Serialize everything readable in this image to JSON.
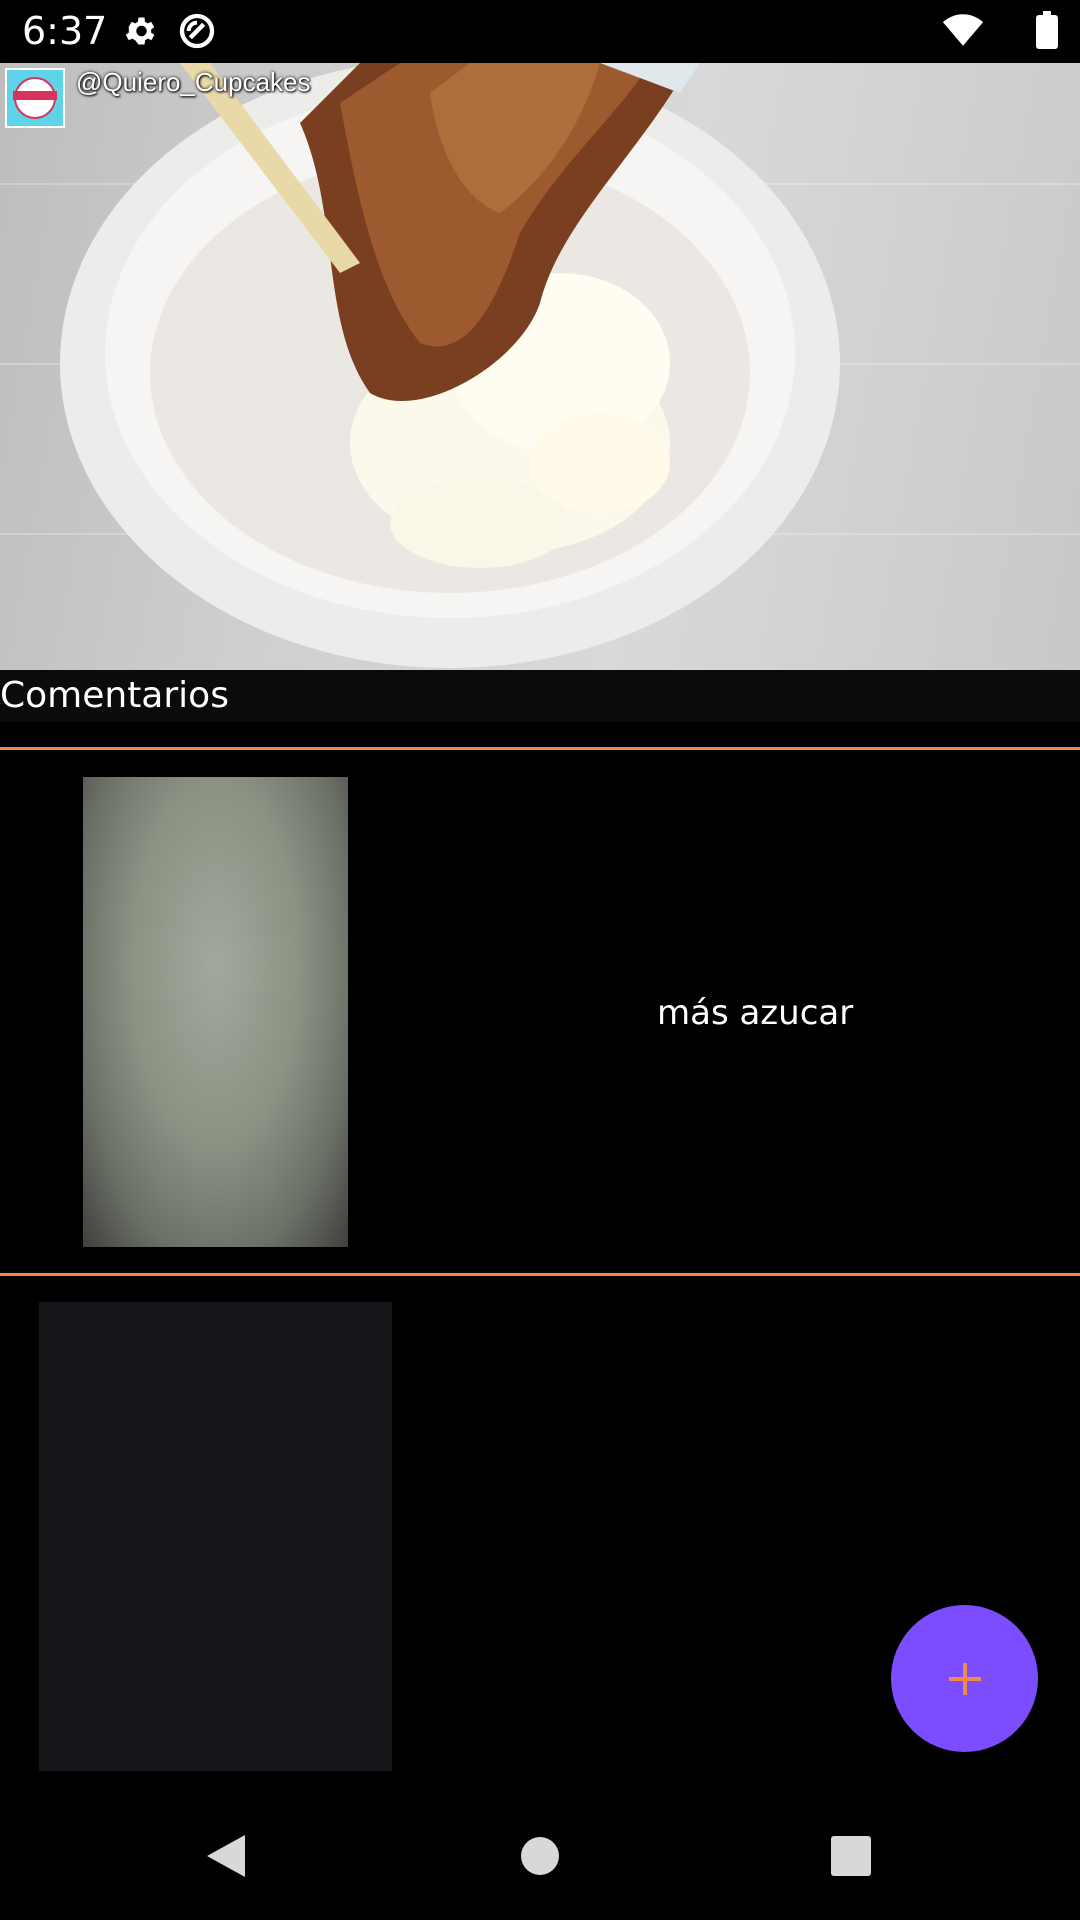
{
  "status_bar": {
    "time": "6:37",
    "icons": [
      "gear-icon",
      "sync-icon",
      "wifi-icon",
      "battery-icon"
    ]
  },
  "video": {
    "channel_handle": "@Quiero_Cupcakes",
    "logo_icon": "channel-logo"
  },
  "comments": {
    "title": "Comentarios",
    "items": [
      {
        "text": "más azucar"
      },
      {
        "text": ""
      }
    ]
  },
  "fab": {
    "label": "+",
    "icon": "plus-icon"
  },
  "nav_bar": {
    "icons": [
      "back-icon",
      "home-icon",
      "recents-icon"
    ]
  },
  "colors": {
    "accent": "#f08a4b",
    "fab": "#7c4dff",
    "background": "#000000"
  }
}
